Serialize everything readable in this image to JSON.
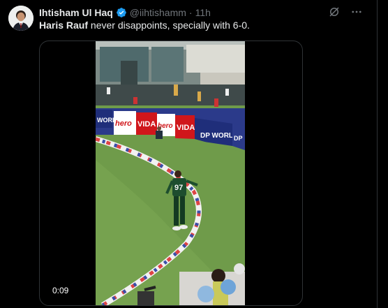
{
  "tweet": {
    "display_name": "Ihtisham Ul Haq",
    "handle": "@iihtishamm",
    "separator": "·",
    "time": "11h",
    "text_bold": "Haris Rauf",
    "text_rest": " never disappoints, specially with 6-0."
  },
  "video": {
    "duration": "0:09",
    "jersey_number": "97",
    "boards": [
      "WORLD",
      "hero",
      "VIDA",
      "hero",
      "VIDA",
      "DP WORLD",
      "DP"
    ]
  },
  "icons": {
    "verified": "verified-badge-icon",
    "grok": "grok-icon",
    "more": "more-options-icon"
  },
  "colors": {
    "verified_blue": "#1d9bf0",
    "background": "#000000",
    "secondary_text": "#71767b",
    "primary_text": "#e7e9ea",
    "pitch_green": "#6f9b4a"
  }
}
